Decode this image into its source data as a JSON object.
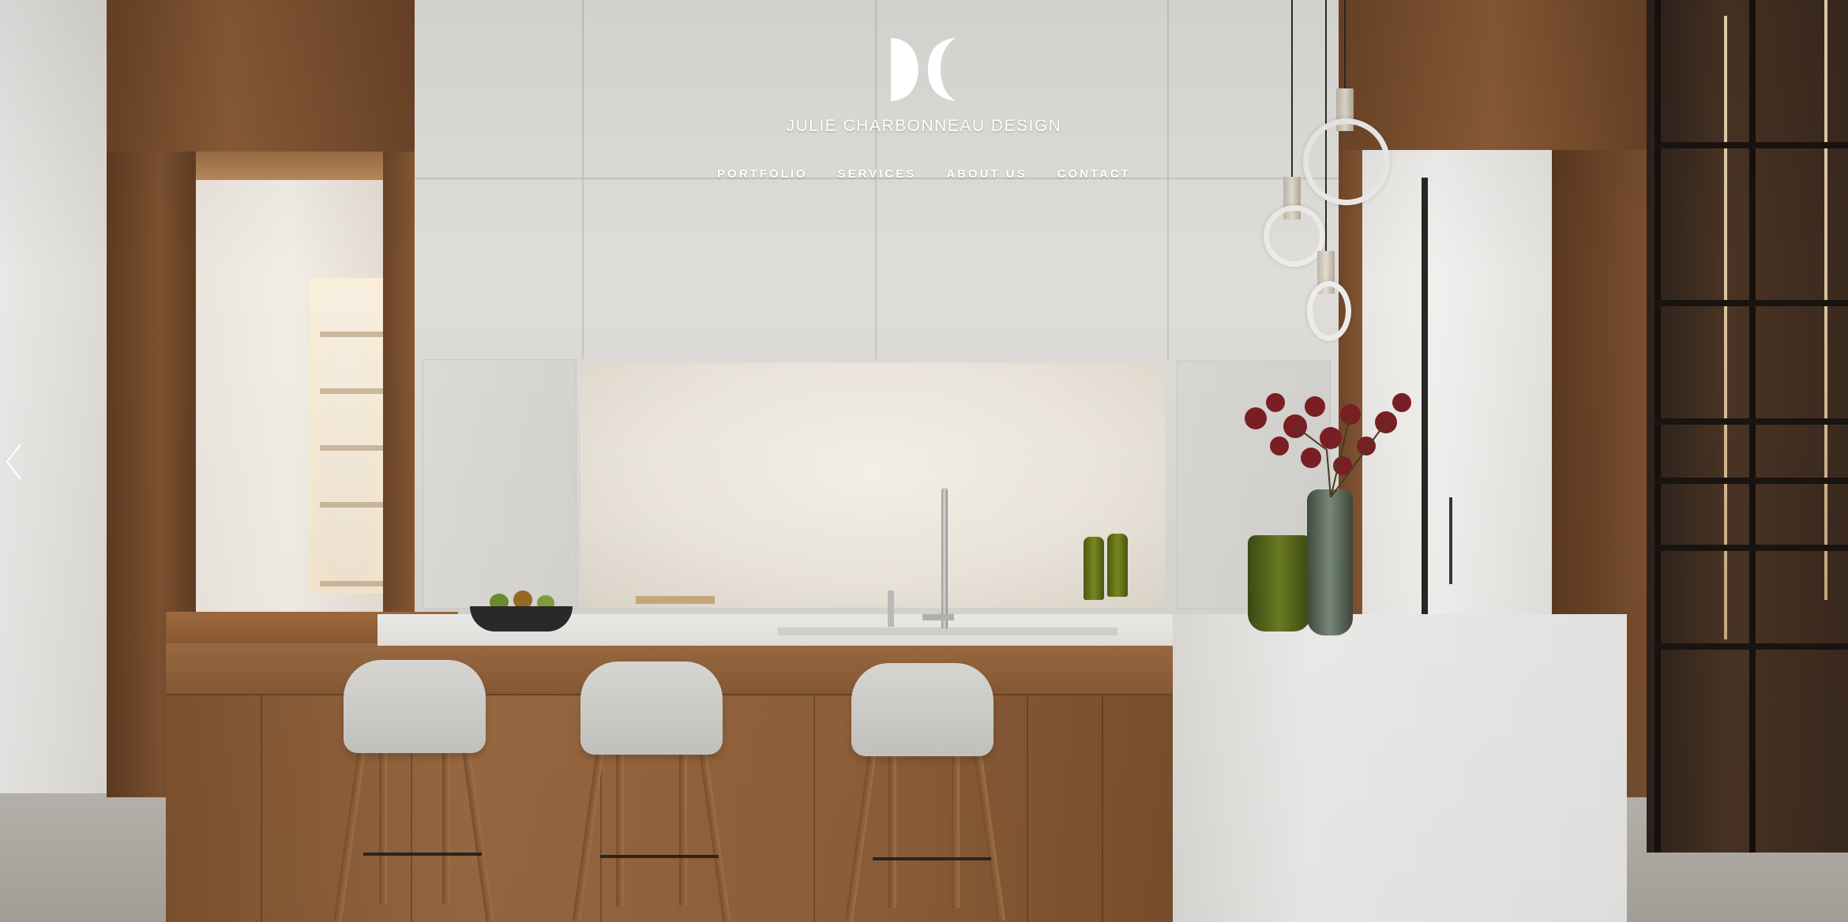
{
  "brand": {
    "name": "JULIE CHARBONNEAU DESIGN",
    "logo_icon": "dc-monogram-icon"
  },
  "nav": {
    "items": [
      {
        "label": "PORTFOLIO"
      },
      {
        "label": "SERVICES"
      },
      {
        "label": "ABOUT US"
      },
      {
        "label": "CONTACT"
      }
    ]
  },
  "slider": {
    "prev_icon": "chevron-left-icon"
  },
  "colors": {
    "nav_text": "#ffffff",
    "wood": "#8a5c38",
    "marble": "#e3e2df"
  }
}
